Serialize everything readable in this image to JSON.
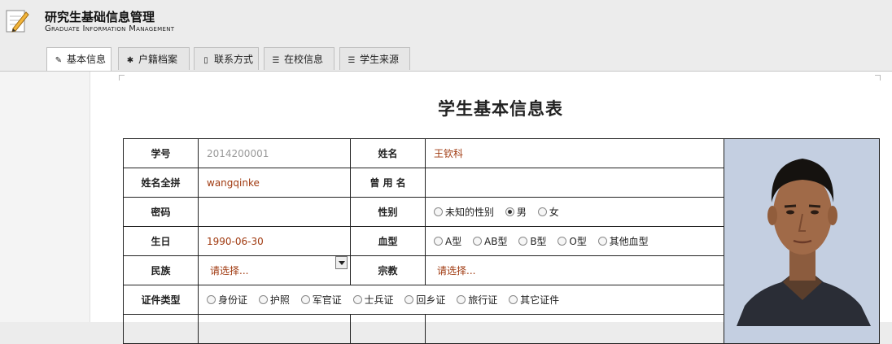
{
  "app": {
    "title": "研究生基础信息管理",
    "subtitle": "Graduate Information Management"
  },
  "tabs": [
    {
      "label": "基本信息",
      "icon": "pencil-icon",
      "active": true
    },
    {
      "label": "户籍档案",
      "icon": "gear-icon",
      "active": false
    },
    {
      "label": "联系方式",
      "icon": "mobile-phone-icon",
      "active": false
    },
    {
      "label": "在校信息",
      "icon": "list-icon",
      "active": false
    },
    {
      "label": "学生来源",
      "icon": "list-icon",
      "active": false
    }
  ],
  "form": {
    "title": "学生基本信息表",
    "rows": {
      "student_id": {
        "label": "学号",
        "value": "2014200001"
      },
      "name": {
        "label": "姓名",
        "value": "王钦科"
      },
      "pinyin": {
        "label": "姓名全拼",
        "value": "wangqinke"
      },
      "former_name": {
        "label": "曾 用 名",
        "value": ""
      },
      "password": {
        "label": "密码",
        "value": ""
      },
      "gender": {
        "label": "性别",
        "options": [
          "未知的性别",
          "男",
          "女"
        ],
        "selected": "男"
      },
      "birthday": {
        "label": "生日",
        "value": "1990-06-30"
      },
      "blood_type": {
        "label": "血型",
        "options": [
          "A型",
          "AB型",
          "B型",
          "O型",
          "其他血型"
        ],
        "selected": null
      },
      "ethnicity": {
        "label": "民族",
        "placeholder": "请选择..."
      },
      "religion": {
        "label": "宗教",
        "placeholder": "请选择..."
      },
      "id_type": {
        "label": "证件类型",
        "options": [
          "身份证",
          "护照",
          "军官证",
          "士兵证",
          "回乡证",
          "旅行证",
          "其它证件"
        ],
        "selected": null
      }
    }
  },
  "colors": {
    "value_text": "#a03a10",
    "placeholder_gray": "#999999",
    "photo_bg": "#c4cfe1"
  }
}
